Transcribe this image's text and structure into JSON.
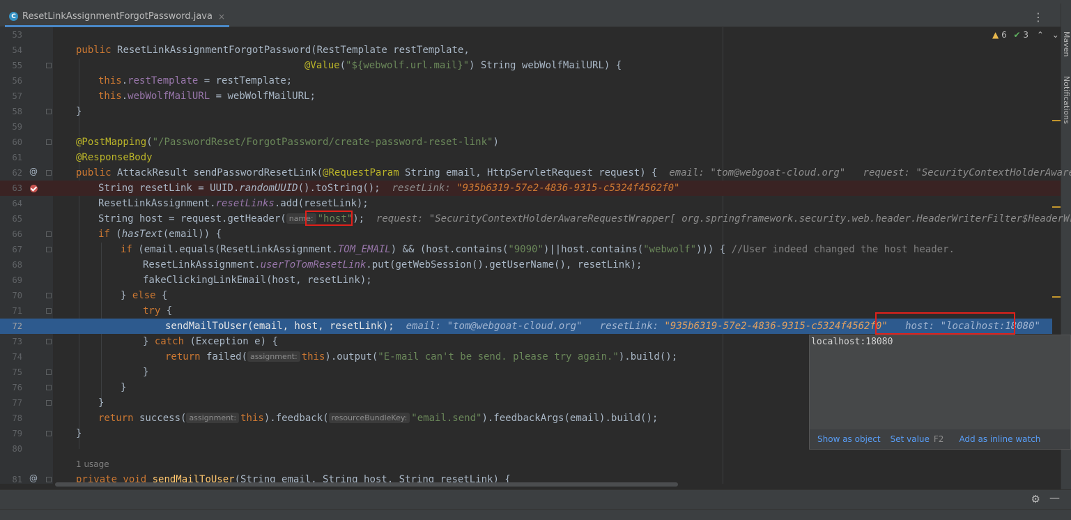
{
  "editor": {
    "tab": {
      "label": "ResetLinkAssignmentForgotPassword.java",
      "close": "×",
      "icon": "C"
    },
    "tab_menu": "⋮",
    "inspections": {
      "warnings": "6",
      "ok": "3"
    },
    "sidebar": {
      "maven": "Maven",
      "notifications": "Notifications"
    },
    "line_numbers": [
      "53",
      "54",
      "55",
      "56",
      "57",
      "58",
      "59",
      "60",
      "61",
      "62",
      "63",
      "64",
      "65",
      "66",
      "67",
      "68",
      "69",
      "70",
      "71",
      "72",
      "73",
      "74",
      "75",
      "76",
      "77",
      "78",
      "79",
      "80",
      "81"
    ],
    "usage_hint": "1 usage",
    "accent": "#2d5a8e",
    "breakpoint_color": "#c75450"
  },
  "code": {
    "l54": {
      "kw": "public",
      "name": "ResetLinkAssignmentForgotPassword",
      "rest": "(RestTemplate restTemplate,"
    },
    "l55": {
      "ann": "@Value",
      "open": "(",
      "str": "\"${webwolf.url.mail}\"",
      "rest": ") String webWolfMailURL) {"
    },
    "l56": {
      "kw": "this",
      "dot": ".",
      "field": "restTemplate",
      "rest": " = restTemplate;"
    },
    "l57": {
      "kw": "this",
      "dot": ".",
      "field": "webWolfMailURL",
      "rest": " = webWolfMailURL;"
    },
    "l58": "}",
    "l60": {
      "ann": "@PostMapping",
      "open": "(",
      "str": "\"/PasswordReset/ForgotPassword/create-password-reset-link\"",
      "close": ")"
    },
    "l61": {
      "ann": "@ResponseBody"
    },
    "l62": {
      "kw": "public",
      "type": " AttackResult ",
      "name": "sendPasswordResetLink",
      "open": "(",
      "ann": "@RequestParam",
      "rest": " String email, HttpServletRequest request) {",
      "dbg1": "email: \"tom@webgoat-cloud.org\"",
      "dbg2": "request: \"SecurityContextHolderAwareReques"
    },
    "l63": {
      "pre": "String resetLink = UUID.",
      "ital": "randomUUID",
      "rest": "().toString();",
      "dbg_name": "resetLink: ",
      "dbg_val": "\"935b6319-57e2-4836-9315-c5324f4562f0\""
    },
    "l64": {
      "pre": "ResetLinkAssignment.",
      "field": "resetLinks",
      "rest": ".add(resetLink);"
    },
    "l65": {
      "pre": "String host = request.getHeader(",
      "inlay": "name:",
      "str": "\"host\"",
      "rest": ");",
      "dbg": "request: \"SecurityContextHolderAwareRequestWrapper[ org.springframework.security.web.header.HeaderWriterFilter$HeaderWriterRe"
    },
    "l66": {
      "kw": "if",
      "open": " (",
      "ital": "hasText",
      "rest": "(email)) {"
    },
    "l67": {
      "kw": "if",
      "pre": " (email.equals(ResetLinkAssignment.",
      "stat": "TOM_EMAIL",
      "mid": ") && (host.contains(",
      "str1": "\"9090\"",
      "mid2": ")||host.contains(",
      "str2": "\"webwolf\"",
      "rest": "))) { ",
      "cmt": "//User indeed changed the host header."
    },
    "l68": {
      "pre": "ResetLinkAssignment.",
      "field": "userToTomResetLink",
      "rest": ".put(getWebSession().getUserName(), resetLink);"
    },
    "l69": "fakeClickingLinkEmail(host, resetLink);",
    "l70": {
      "pre": "} ",
      "kw": "else",
      "rest": " {"
    },
    "l71": {
      "kw": "try",
      "rest": " {"
    },
    "l72": {
      "code": "sendMailToUser(email, host, resetLink);",
      "dbg1": "email: \"tom@webgoat-cloud.org\"",
      "dbg2n": "resetLink: ",
      "dbg2v": "\"935b6319-57e2-4836-9315-c5324f4562f0\"",
      "dbg3": "host: \"localhost:18080\""
    },
    "l73": {
      "pre": "} ",
      "kw": "catch",
      "rest": " (Exception e) {"
    },
    "l74": {
      "kw": "return",
      "pre": " failed(",
      "inlay": "assignment:",
      "kw2": "this",
      "mid": ").output(",
      "str": "\"E-mail can't be send. please try again.\"",
      "rest": ").build();"
    },
    "l75": "}",
    "l76": "}",
    "l77": "}",
    "l78": {
      "kw": "return",
      "pre": " success(",
      "inlay1": "assignment:",
      "kw2": "this",
      "mid": ").feedback(",
      "inlay2": "resourceBundleKey:",
      "str": "\"email.send\"",
      "rest": ").feedbackArgs(email).build();"
    },
    "l79": "}",
    "l81": {
      "kw": "private void",
      "name": " sendMailToUser",
      "rest": "(String email, String host, String resetLink) {"
    }
  },
  "popup": {
    "value": "localhost:18080",
    "show_as_object": "Show as object",
    "set_value": "Set value",
    "set_value_key": "F2",
    "add_inline_watch": "Add as inline watch"
  },
  "gutter_marks": {
    "override": "@"
  },
  "status": {
    "gear": "⚙",
    "minimize": "—"
  }
}
